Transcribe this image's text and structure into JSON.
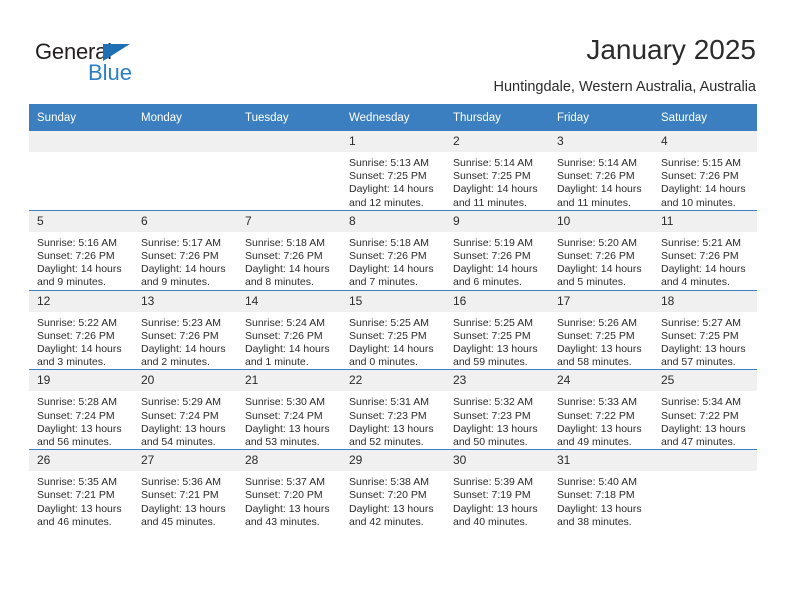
{
  "brand": {
    "name_top": "General",
    "name_bottom": "Blue",
    "accent_color": "#2a7fc9",
    "triangle_color": "#1f6fb5"
  },
  "header": {
    "title": "January 2025",
    "subtitle": "Huntingdale, Western Australia, Australia"
  },
  "theme": {
    "header_row_bg": "#3c7fc0",
    "daynum_bg": "#f0f0f0",
    "text_color": "#2b2b2b"
  },
  "weekday_headers": [
    "Sunday",
    "Monday",
    "Tuesday",
    "Wednesday",
    "Thursday",
    "Friday",
    "Saturday"
  ],
  "labels": {
    "sunrise_prefix": "Sunrise: ",
    "sunset_prefix": "Sunset: ",
    "daylight_prefix": "Daylight: "
  },
  "weeks": [
    [
      {
        "blank": true,
        "day": "",
        "sunrise": "",
        "sunset": "",
        "daylight_a": "",
        "daylight_b": ""
      },
      {
        "blank": true,
        "day": "",
        "sunrise": "",
        "sunset": "",
        "daylight_a": "",
        "daylight_b": ""
      },
      {
        "blank": true,
        "day": "",
        "sunrise": "",
        "sunset": "",
        "daylight_a": "",
        "daylight_b": ""
      },
      {
        "blank": false,
        "day": "1",
        "sunrise": "Sunrise: 5:13 AM",
        "sunset": "Sunset: 7:25 PM",
        "daylight_a": "Daylight: 14 hours",
        "daylight_b": "and 12 minutes."
      },
      {
        "blank": false,
        "day": "2",
        "sunrise": "Sunrise: 5:14 AM",
        "sunset": "Sunset: 7:25 PM",
        "daylight_a": "Daylight: 14 hours",
        "daylight_b": "and 11 minutes."
      },
      {
        "blank": false,
        "day": "3",
        "sunrise": "Sunrise: 5:14 AM",
        "sunset": "Sunset: 7:26 PM",
        "daylight_a": "Daylight: 14 hours",
        "daylight_b": "and 11 minutes."
      },
      {
        "blank": false,
        "day": "4",
        "sunrise": "Sunrise: 5:15 AM",
        "sunset": "Sunset: 7:26 PM",
        "daylight_a": "Daylight: 14 hours",
        "daylight_b": "and 10 minutes."
      }
    ],
    [
      {
        "blank": false,
        "day": "5",
        "sunrise": "Sunrise: 5:16 AM",
        "sunset": "Sunset: 7:26 PM",
        "daylight_a": "Daylight: 14 hours",
        "daylight_b": "and 9 minutes."
      },
      {
        "blank": false,
        "day": "6",
        "sunrise": "Sunrise: 5:17 AM",
        "sunset": "Sunset: 7:26 PM",
        "daylight_a": "Daylight: 14 hours",
        "daylight_b": "and 9 minutes."
      },
      {
        "blank": false,
        "day": "7",
        "sunrise": "Sunrise: 5:18 AM",
        "sunset": "Sunset: 7:26 PM",
        "daylight_a": "Daylight: 14 hours",
        "daylight_b": "and 8 minutes."
      },
      {
        "blank": false,
        "day": "8",
        "sunrise": "Sunrise: 5:18 AM",
        "sunset": "Sunset: 7:26 PM",
        "daylight_a": "Daylight: 14 hours",
        "daylight_b": "and 7 minutes."
      },
      {
        "blank": false,
        "day": "9",
        "sunrise": "Sunrise: 5:19 AM",
        "sunset": "Sunset: 7:26 PM",
        "daylight_a": "Daylight: 14 hours",
        "daylight_b": "and 6 minutes."
      },
      {
        "blank": false,
        "day": "10",
        "sunrise": "Sunrise: 5:20 AM",
        "sunset": "Sunset: 7:26 PM",
        "daylight_a": "Daylight: 14 hours",
        "daylight_b": "and 5 minutes."
      },
      {
        "blank": false,
        "day": "11",
        "sunrise": "Sunrise: 5:21 AM",
        "sunset": "Sunset: 7:26 PM",
        "daylight_a": "Daylight: 14 hours",
        "daylight_b": "and 4 minutes."
      }
    ],
    [
      {
        "blank": false,
        "day": "12",
        "sunrise": "Sunrise: 5:22 AM",
        "sunset": "Sunset: 7:26 PM",
        "daylight_a": "Daylight: 14 hours",
        "daylight_b": "and 3 minutes."
      },
      {
        "blank": false,
        "day": "13",
        "sunrise": "Sunrise: 5:23 AM",
        "sunset": "Sunset: 7:26 PM",
        "daylight_a": "Daylight: 14 hours",
        "daylight_b": "and 2 minutes."
      },
      {
        "blank": false,
        "day": "14",
        "sunrise": "Sunrise: 5:24 AM",
        "sunset": "Sunset: 7:26 PM",
        "daylight_a": "Daylight: 14 hours",
        "daylight_b": "and 1 minute."
      },
      {
        "blank": false,
        "day": "15",
        "sunrise": "Sunrise: 5:25 AM",
        "sunset": "Sunset: 7:25 PM",
        "daylight_a": "Daylight: 14 hours",
        "daylight_b": "and 0 minutes."
      },
      {
        "blank": false,
        "day": "16",
        "sunrise": "Sunrise: 5:25 AM",
        "sunset": "Sunset: 7:25 PM",
        "daylight_a": "Daylight: 13 hours",
        "daylight_b": "and 59 minutes."
      },
      {
        "blank": false,
        "day": "17",
        "sunrise": "Sunrise: 5:26 AM",
        "sunset": "Sunset: 7:25 PM",
        "daylight_a": "Daylight: 13 hours",
        "daylight_b": "and 58 minutes."
      },
      {
        "blank": false,
        "day": "18",
        "sunrise": "Sunrise: 5:27 AM",
        "sunset": "Sunset: 7:25 PM",
        "daylight_a": "Daylight: 13 hours",
        "daylight_b": "and 57 minutes."
      }
    ],
    [
      {
        "blank": false,
        "day": "19",
        "sunrise": "Sunrise: 5:28 AM",
        "sunset": "Sunset: 7:24 PM",
        "daylight_a": "Daylight: 13 hours",
        "daylight_b": "and 56 minutes."
      },
      {
        "blank": false,
        "day": "20",
        "sunrise": "Sunrise: 5:29 AM",
        "sunset": "Sunset: 7:24 PM",
        "daylight_a": "Daylight: 13 hours",
        "daylight_b": "and 54 minutes."
      },
      {
        "blank": false,
        "day": "21",
        "sunrise": "Sunrise: 5:30 AM",
        "sunset": "Sunset: 7:24 PM",
        "daylight_a": "Daylight: 13 hours",
        "daylight_b": "and 53 minutes."
      },
      {
        "blank": false,
        "day": "22",
        "sunrise": "Sunrise: 5:31 AM",
        "sunset": "Sunset: 7:23 PM",
        "daylight_a": "Daylight: 13 hours",
        "daylight_b": "and 52 minutes."
      },
      {
        "blank": false,
        "day": "23",
        "sunrise": "Sunrise: 5:32 AM",
        "sunset": "Sunset: 7:23 PM",
        "daylight_a": "Daylight: 13 hours",
        "daylight_b": "and 50 minutes."
      },
      {
        "blank": false,
        "day": "24",
        "sunrise": "Sunrise: 5:33 AM",
        "sunset": "Sunset: 7:22 PM",
        "daylight_a": "Daylight: 13 hours",
        "daylight_b": "and 49 minutes."
      },
      {
        "blank": false,
        "day": "25",
        "sunrise": "Sunrise: 5:34 AM",
        "sunset": "Sunset: 7:22 PM",
        "daylight_a": "Daylight: 13 hours",
        "daylight_b": "and 47 minutes."
      }
    ],
    [
      {
        "blank": false,
        "day": "26",
        "sunrise": "Sunrise: 5:35 AM",
        "sunset": "Sunset: 7:21 PM",
        "daylight_a": "Daylight: 13 hours",
        "daylight_b": "and 46 minutes."
      },
      {
        "blank": false,
        "day": "27",
        "sunrise": "Sunrise: 5:36 AM",
        "sunset": "Sunset: 7:21 PM",
        "daylight_a": "Daylight: 13 hours",
        "daylight_b": "and 45 minutes."
      },
      {
        "blank": false,
        "day": "28",
        "sunrise": "Sunrise: 5:37 AM",
        "sunset": "Sunset: 7:20 PM",
        "daylight_a": "Daylight: 13 hours",
        "daylight_b": "and 43 minutes."
      },
      {
        "blank": false,
        "day": "29",
        "sunrise": "Sunrise: 5:38 AM",
        "sunset": "Sunset: 7:20 PM",
        "daylight_a": "Daylight: 13 hours",
        "daylight_b": "and 42 minutes."
      },
      {
        "blank": false,
        "day": "30",
        "sunrise": "Sunrise: 5:39 AM",
        "sunset": "Sunset: 7:19 PM",
        "daylight_a": "Daylight: 13 hours",
        "daylight_b": "and 40 minutes."
      },
      {
        "blank": false,
        "day": "31",
        "sunrise": "Sunrise: 5:40 AM",
        "sunset": "Sunset: 7:18 PM",
        "daylight_a": "Daylight: 13 hours",
        "daylight_b": "and 38 minutes."
      },
      {
        "blank": true,
        "day": "",
        "sunrise": "",
        "sunset": "",
        "daylight_a": "",
        "daylight_b": ""
      }
    ]
  ]
}
